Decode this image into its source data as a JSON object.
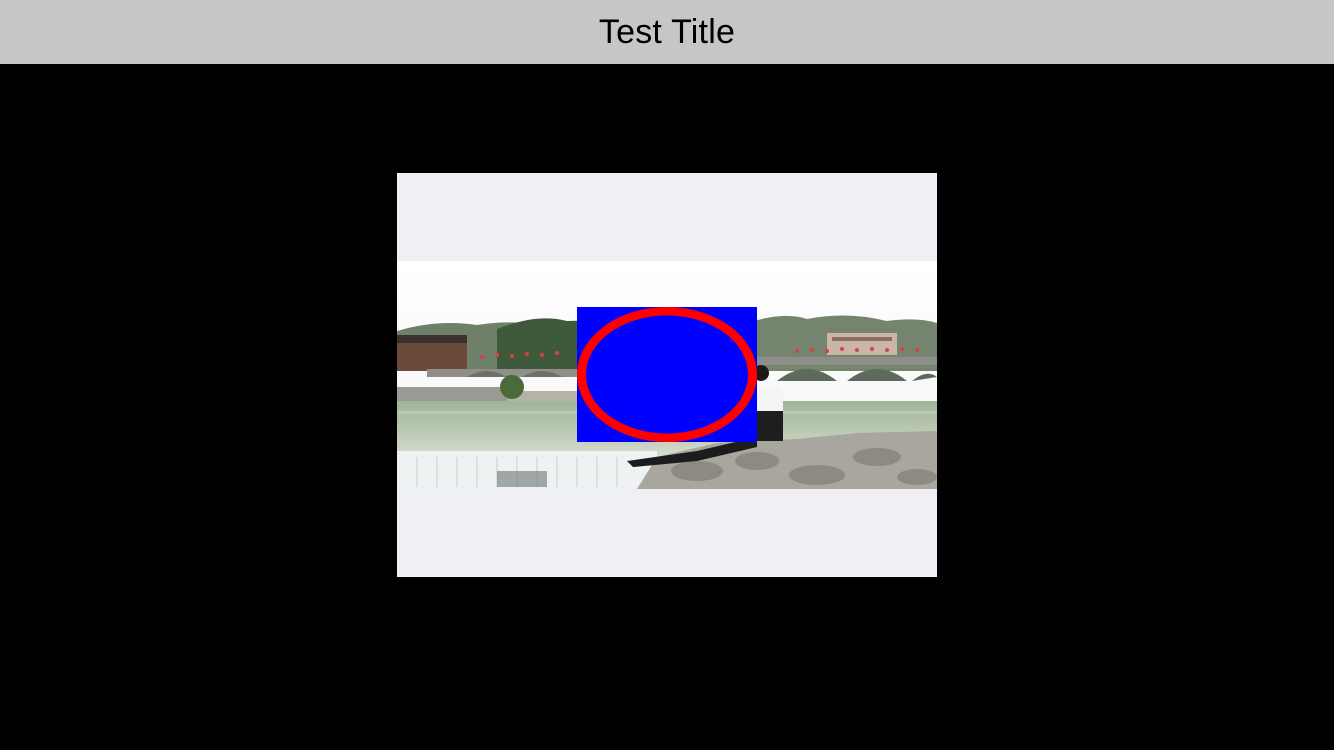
{
  "nav": {
    "title": "Test Title"
  },
  "media": {
    "photo_icon": "landscape-photo",
    "overlay_icon": "ellipse-shape",
    "colors": {
      "panel_background": "#efeff4",
      "overlay_fill": "#0000ff",
      "overlay_ring": "#ff0000",
      "nav_background": "#c6c6c6",
      "page_background": "#000000"
    }
  }
}
